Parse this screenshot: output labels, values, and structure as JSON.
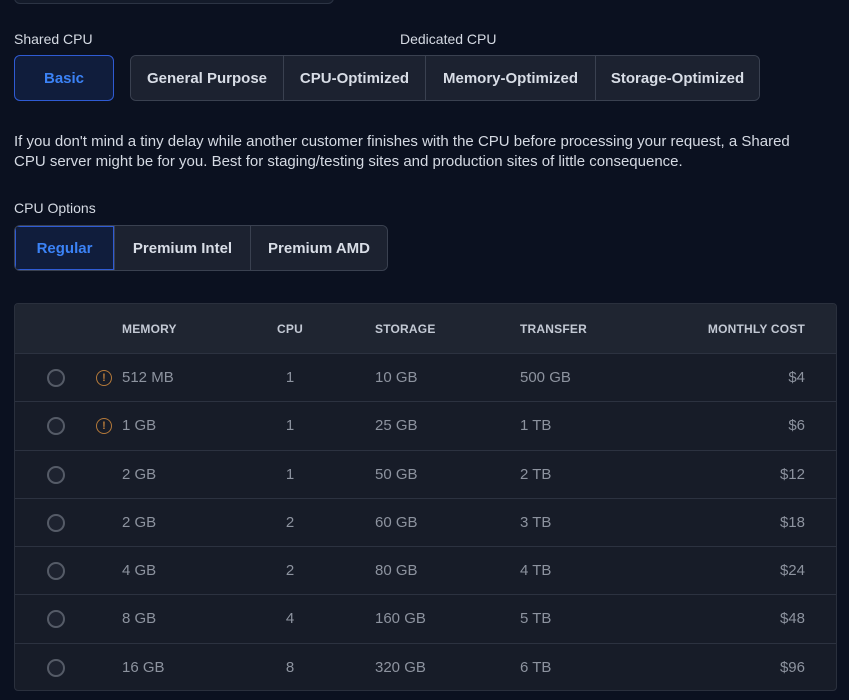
{
  "shared_cpu": {
    "label": "Shared CPU",
    "button": "Basic"
  },
  "dedicated_cpu": {
    "label": "Dedicated CPU",
    "buttons": [
      "General Purpose",
      "CPU-Optimized",
      "Memory-Optimized",
      "Storage-Optimized"
    ]
  },
  "description": "If you don't mind a tiny delay while another customer finishes with the CPU before processing your request, a Shared CPU server might be for you. Best for staging/testing sites and production sites of little consequence.",
  "cpu_options": {
    "label": "CPU Options",
    "buttons": [
      "Regular",
      "Premium Intel",
      "Premium AMD"
    ],
    "selected": "Regular"
  },
  "table": {
    "headers": {
      "memory": "MEMORY",
      "cpu": "CPU",
      "storage": "STORAGE",
      "transfer": "TRANSFER",
      "cost": "MONTHLY COST"
    },
    "rows": [
      {
        "memory": "512 MB",
        "cpu": "1",
        "storage": "10 GB",
        "transfer": "500 GB",
        "cost": "$4",
        "warning": true
      },
      {
        "memory": "1 GB",
        "cpu": "1",
        "storage": "25 GB",
        "transfer": "1 TB",
        "cost": "$6",
        "warning": true
      },
      {
        "memory": "2 GB",
        "cpu": "1",
        "storage": "50 GB",
        "transfer": "2 TB",
        "cost": "$12",
        "warning": false
      },
      {
        "memory": "2 GB",
        "cpu": "2",
        "storage": "60 GB",
        "transfer": "3 TB",
        "cost": "$18",
        "warning": false
      },
      {
        "memory": "4 GB",
        "cpu": "2",
        "storage": "80 GB",
        "transfer": "4 TB",
        "cost": "$24",
        "warning": false
      },
      {
        "memory": "8 GB",
        "cpu": "4",
        "storage": "160 GB",
        "transfer": "5 TB",
        "cost": "$48",
        "warning": false
      },
      {
        "memory": "16 GB",
        "cpu": "8",
        "storage": "320 GB",
        "transfer": "6 TB",
        "cost": "$96",
        "warning": false
      }
    ]
  },
  "icons": {
    "warning": "warning-circle-icon",
    "warning_glyph": "!"
  },
  "colors": {
    "accent": "#3b82f6",
    "warning": "#b4793a"
  }
}
